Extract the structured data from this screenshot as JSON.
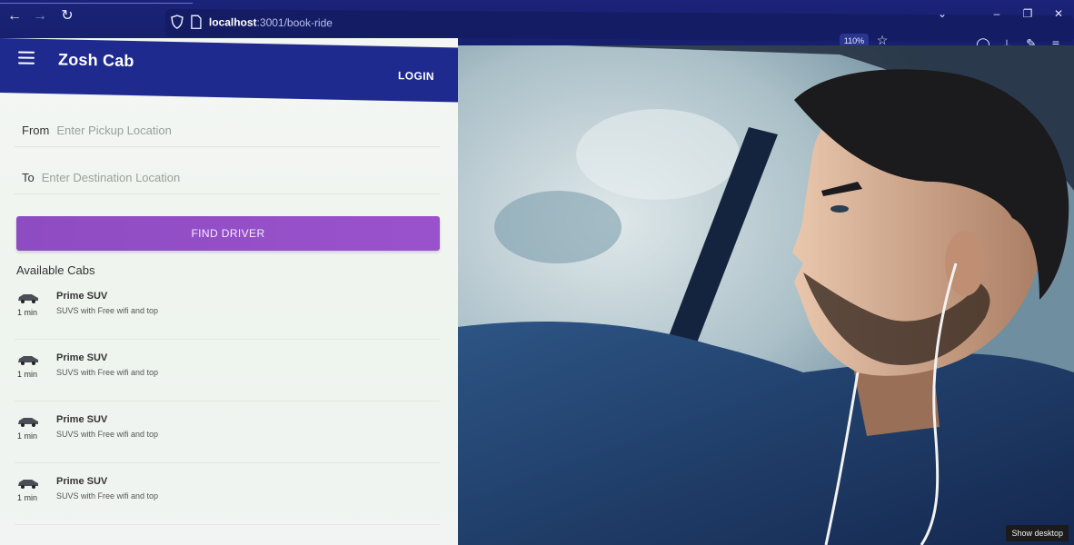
{
  "browser": {
    "url_host": "localhost",
    "url_path": ":3001/book-ride",
    "zoom": "110%"
  },
  "app": {
    "brand": "Zosh Cab",
    "login_label": "LOGIN"
  },
  "form": {
    "from_label": "From",
    "from_placeholder": "Enter Pickup Location",
    "to_label": "To",
    "to_placeholder": "Enter Destination Location",
    "find_button": "FIND DRIVER"
  },
  "cabs": {
    "title": "Available Cabs",
    "items": [
      {
        "name": "Prime SUV",
        "description": "SUVS with Free wifi and top",
        "eta": "1 min"
      },
      {
        "name": "Prime SUV",
        "description": "SUVS with Free wifi and top",
        "eta": "1 min"
      },
      {
        "name": "Prime SUV",
        "description": "SUVS with Free wifi and top",
        "eta": "1 min"
      },
      {
        "name": "Prime SUV",
        "description": "SUVS with Free wifi and top",
        "eta": "1 min"
      }
    ]
  },
  "os": {
    "show_desktop": "Show desktop"
  },
  "icons": {
    "back": "arrow-left-icon",
    "forward": "arrow-right-icon",
    "reload": "reload-icon",
    "shield": "shield-icon",
    "page": "page-icon",
    "bookmark": "star-icon",
    "pocket": "pocket-icon",
    "downloads": "download-icon",
    "extensions": "puzzle-icon",
    "menu": "hamburger-icon",
    "car": "car-icon"
  },
  "colors": {
    "appbar": "#1f2a8e",
    "button": "#9a52cc",
    "chrome": "#1a2378"
  }
}
